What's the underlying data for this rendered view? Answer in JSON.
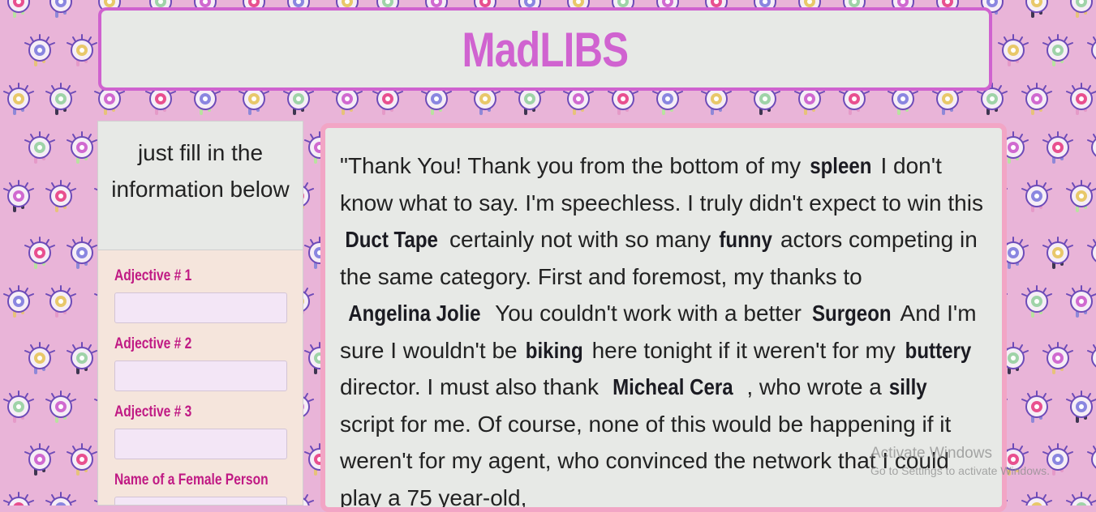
{
  "app": {
    "title": "MadLIBS"
  },
  "sidebar": {
    "intro": "just fill in the information below",
    "fields": [
      {
        "label": "Adjective # 1",
        "value": ""
      },
      {
        "label": "Adjective # 2",
        "value": ""
      },
      {
        "label": "Adjective # 3",
        "value": ""
      },
      {
        "label": "Name of a Female Person",
        "value": ""
      }
    ]
  },
  "story": {
    "segments": [
      {
        "text": "\"Thank You! Thank you from the bottom of my ",
        "filled": false
      },
      {
        "text": "spleen",
        "filled": true
      },
      {
        "text": " I don't know what to say. I'm speechless. I truly didn't expect to win this ",
        "filled": false
      },
      {
        "text": "Duct Tape",
        "filled": true
      },
      {
        "text": " certainly not with so many ",
        "filled": false
      },
      {
        "text": "funny",
        "filled": true
      },
      {
        "text": " actors competing in the same category. First and foremost, my thanks to ",
        "filled": false
      },
      {
        "text": "Angelina Jolie",
        "filled": true
      },
      {
        "text": " You couldn't work with a better ",
        "filled": false
      },
      {
        "text": "Surgeon",
        "filled": true
      },
      {
        "text": " And I'm sure I wouldn't be ",
        "filled": false
      },
      {
        "text": "biking",
        "filled": true
      },
      {
        "text": " here tonight if it weren't for my ",
        "filled": false
      },
      {
        "text": "buttery",
        "filled": true
      },
      {
        "text": " director. I must also thank ",
        "filled": false
      },
      {
        "text": "Micheal Cera",
        "filled": true
      },
      {
        "text": " , who wrote a ",
        "filled": false
      },
      {
        "text": "silly",
        "filled": true
      },
      {
        "text": " script for me. Of course, none of this would be happening if it weren't for my agent, who convinced the network that I could play a 75 year-old,",
        "filled": false
      }
    ]
  },
  "watermark": {
    "title": "Activate Windows",
    "subtitle": "Go to Settings to activate Windows."
  },
  "colors": {
    "background": "#e9b4d8",
    "title": "#d063d0",
    "label": "#c01a84",
    "story_border": "#f2a5c5",
    "panel": "#e7e9e6",
    "form_bg": "#f5e5dc"
  }
}
